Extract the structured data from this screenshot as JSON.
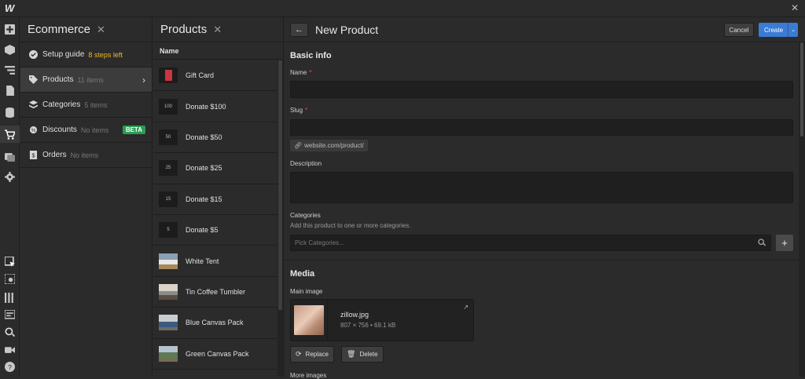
{
  "app": {
    "logo": "W",
    "close_icon": "close-icon"
  },
  "rail": [
    "add-icon",
    "box-icon",
    "navigator-icon",
    "pages-icon",
    "cms-icon",
    "ecommerce-cart-icon",
    "assets-icon",
    "settings-icon",
    "selector-icon",
    "preview-icon",
    "grid-icon",
    "audit-icon",
    "search-icon",
    "video-icon",
    "help-icon"
  ],
  "ecommerce_panel": {
    "title": "Ecommerce",
    "items": [
      {
        "label": "Setup guide",
        "extra": "8 steps left"
      },
      {
        "label": "Products",
        "count": "11 items"
      },
      {
        "label": "Categories",
        "count": "5 items"
      },
      {
        "label": "Discounts",
        "count": "No items",
        "badge": "BETA"
      },
      {
        "label": "Orders",
        "count": "No items"
      }
    ],
    "colors": {
      "steps": "#f3b825",
      "beta": "#2a9d55"
    }
  },
  "products_panel": {
    "title": "Products",
    "column_header": "Name",
    "items": [
      {
        "name": "Gift Card",
        "thumb": ""
      },
      {
        "name": "Donate $100",
        "thumb": "100"
      },
      {
        "name": "Donate $50",
        "thumb": "50"
      },
      {
        "name": "Donate $25",
        "thumb": "25"
      },
      {
        "name": "Donate $15",
        "thumb": "15"
      },
      {
        "name": "Donate $5",
        "thumb": "5"
      },
      {
        "name": "White Tent",
        "thumb": ""
      },
      {
        "name": "Tin Coffee Tumbler",
        "thumb": ""
      },
      {
        "name": "Blue Canvas Pack",
        "thumb": ""
      },
      {
        "name": "Green Canvas Pack",
        "thumb": ""
      }
    ]
  },
  "editor": {
    "title": "New Product",
    "cancel_label": "Cancel",
    "create_label": "Create",
    "basic_info": {
      "title": "Basic info",
      "name_label": "Name",
      "slug_label": "Slug",
      "slug_hint": "website.com/product/",
      "description_label": "Description",
      "categories_label": "Categories",
      "categories_hint": "Add this product to one or more categories.",
      "categories_placeholder": "Pick Categories..."
    },
    "media": {
      "title": "Media",
      "main_image_label": "Main image",
      "file_name": "zillow.jpg",
      "file_meta": "807 × 756 • 69.1 kB",
      "replace_label": "Replace",
      "delete_label": "Delete",
      "more_images_label": "More images"
    },
    "accent": "#3b7bd4"
  }
}
